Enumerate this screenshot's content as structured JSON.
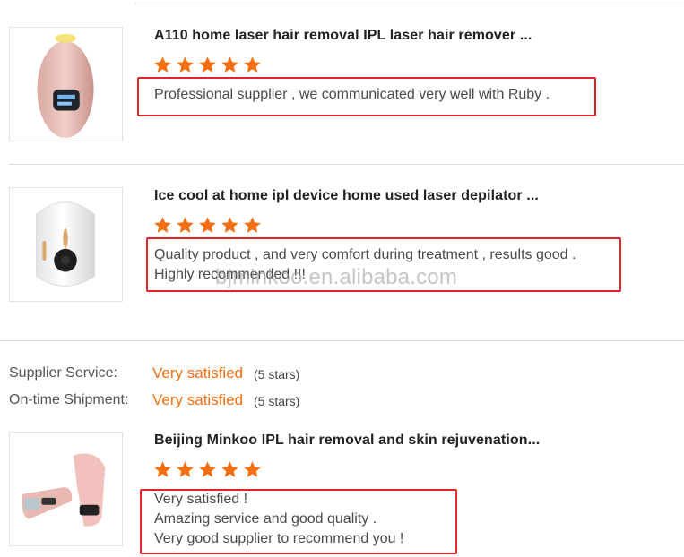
{
  "reviews": [
    {
      "title": "A110 home laser hair removal IPL laser hair remover ...",
      "stars": 5,
      "text_lines": [
        "Professional supplier , we communicated very well with Ruby ."
      ],
      "thumb_icon": "pink-ipl-device-image"
    },
    {
      "title": "Ice cool at home ipl device home used laser depilator ...",
      "stars": 5,
      "text_lines": [
        "Quality product , and very comfort during treatment , results good .",
        "Highly recommended !!!"
      ],
      "thumb_icon": "white-ipl-device-image"
    },
    {
      "title": "Beijing Minkoo IPL hair removal and skin rejuvenation...",
      "stars": 5,
      "text_lines": [
        "Very satisfied !",
        "Amazing service and good quality .",
        "Very good supplier to recommend you !"
      ],
      "thumb_icon": "pink-handheld-ipl-image"
    }
  ],
  "supplier_ratings": [
    {
      "label": "Supplier Service:",
      "value": "Very satisfied",
      "stars_text": "(5 stars)"
    },
    {
      "label": "On-time Shipment:",
      "value": "Very satisfied",
      "stars_text": "(5 stars)"
    }
  ],
  "watermark": "bjminkoo.en.alibaba.com",
  "colors": {
    "star": "#f36f12",
    "highlight_box": "#e0262b",
    "rating_value": "#f36f12"
  }
}
